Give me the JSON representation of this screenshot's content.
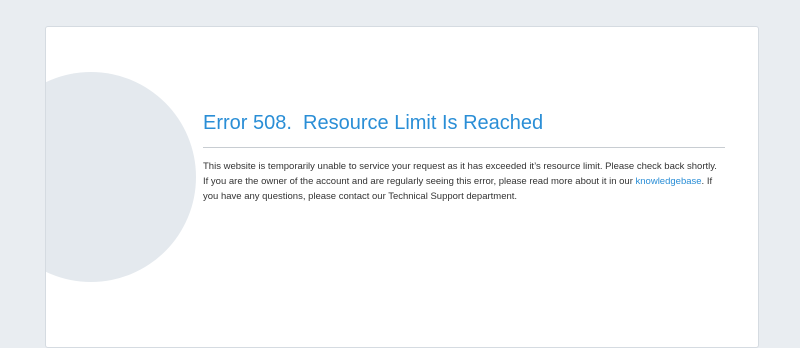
{
  "error": {
    "title": "Error 508.  Resource Limit Is Reached",
    "paragraph1": "This website is temporarily unable to service your request as it has exceeded it’s resource limit. Please check back shortly.",
    "paragraph2_before": "If you are the owner of the account and are regularly seeing this error, please read more about it in our ",
    "link_text": "knowledgebase",
    "paragraph2_after": ". If you have any questions, please contact our Technical Support department."
  },
  "icon": "exclamation-icon",
  "colors": {
    "page_background": "#e9edf1",
    "card_background": "#ffffff",
    "accent": "#2a8ed6",
    "icon_circle": "#e4e9ee",
    "body_text": "#333333"
  }
}
